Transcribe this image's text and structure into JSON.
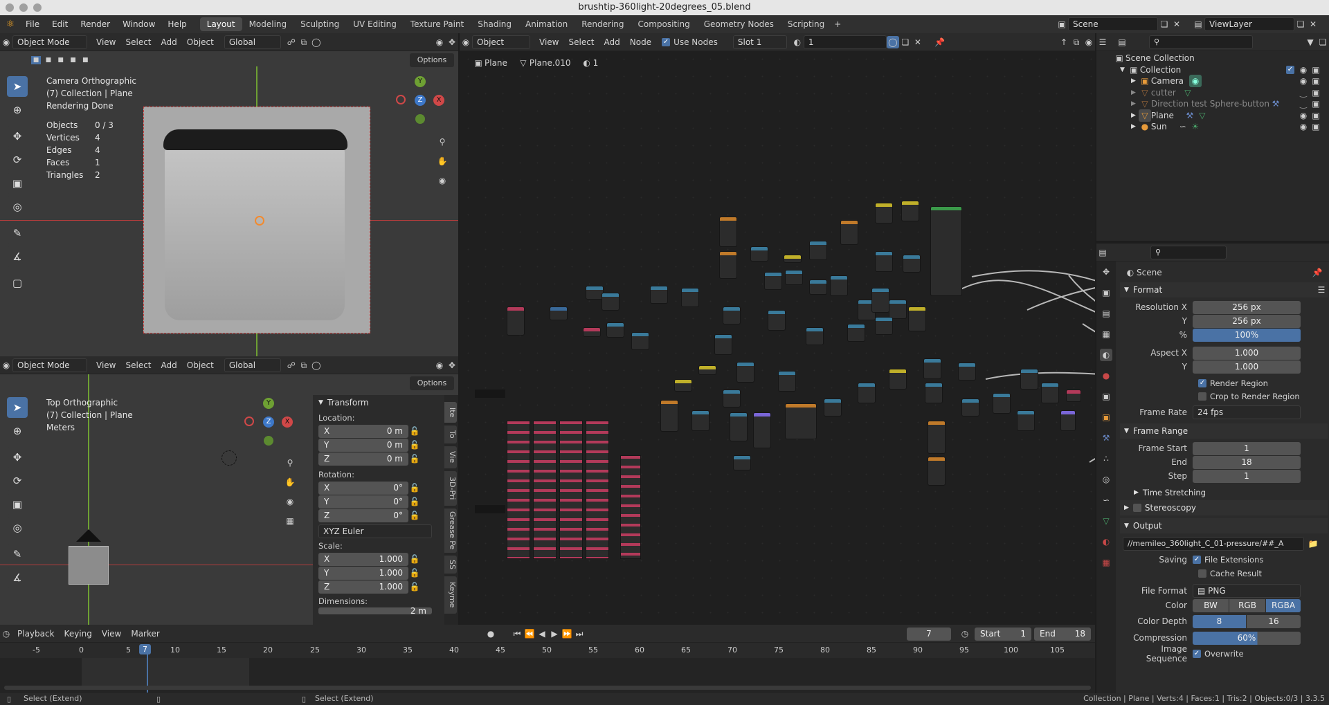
{
  "window": {
    "title": "brushtip-360light-20degrees_05.blend"
  },
  "menu": {
    "items": [
      "File",
      "Edit",
      "Render",
      "Window",
      "Help"
    ]
  },
  "workspaces": [
    "Layout",
    "Modeling",
    "Sculpting",
    "UV Editing",
    "Texture Paint",
    "Shading",
    "Animation",
    "Rendering",
    "Compositing",
    "Geometry Nodes",
    "Scripting"
  ],
  "active_workspace": "Layout",
  "scene_field": "Scene",
  "viewlayer_field": "ViewLayer",
  "viewport_top": {
    "mode": "Object Mode",
    "menus": [
      "View",
      "Select",
      "Add",
      "Object"
    ],
    "orientation": "Global",
    "options": "Options",
    "overlay": [
      "Camera Orthographic",
      "(7) Collection | Plane",
      "Rendering Done"
    ],
    "stats": [
      {
        "label": "Objects",
        "value": "0 / 3"
      },
      {
        "label": "Vertices",
        "value": "4"
      },
      {
        "label": "Edges",
        "value": "4"
      },
      {
        "label": "Faces",
        "value": "1"
      },
      {
        "label": "Triangles",
        "value": "2"
      }
    ],
    "gizmo": {
      "x": "X",
      "y": "Y",
      "z": "Z"
    }
  },
  "viewport_bottom": {
    "mode": "Object Mode",
    "menus": [
      "View",
      "Select",
      "Add",
      "Object"
    ],
    "orientation": "Global",
    "options": "Options",
    "overlay": [
      "Top Orthographic",
      "(7) Collection | Plane",
      "Meters"
    ],
    "transform": {
      "title": "Transform",
      "location_label": "Location:",
      "location": [
        {
          "axis": "X",
          "value": "0 m"
        },
        {
          "axis": "Y",
          "value": "0 m"
        },
        {
          "axis": "Z",
          "value": "0 m"
        }
      ],
      "rotation_label": "Rotation:",
      "rotation": [
        {
          "axis": "X",
          "value": "0°"
        },
        {
          "axis": "Y",
          "value": "0°"
        },
        {
          "axis": "Z",
          "value": "0°"
        }
      ],
      "rotation_mode": "XYZ Euler",
      "scale_label": "Scale:",
      "scale": [
        {
          "axis": "X",
          "value": "1.000"
        },
        {
          "axis": "Y",
          "value": "1.000"
        },
        {
          "axis": "Z",
          "value": "1.000"
        }
      ],
      "dimensions_label": "Dimensions:",
      "dimensions_x": "2 m"
    },
    "side_tabs": [
      "Ite",
      "To",
      "Vie",
      "3D-Pri",
      "Grease Pe",
      "SS",
      "Keyme"
    ]
  },
  "node_editor": {
    "type": "Object",
    "menus": [
      "View",
      "Select",
      "Add",
      "Node"
    ],
    "use_nodes": "Use Nodes",
    "slot": "Slot 1",
    "material_field": "1",
    "breadcrumb": [
      "Plane",
      "Plane.010",
      "1"
    ]
  },
  "outliner": {
    "items": [
      {
        "name": "Scene Collection",
        "indent": 0
      },
      {
        "name": "Collection",
        "indent": 1
      },
      {
        "name": "Camera",
        "indent": 2
      },
      {
        "name": "cutter",
        "indent": 2
      },
      {
        "name": "Direction test Sphere-button",
        "indent": 2
      },
      {
        "name": "Plane",
        "indent": 2
      },
      {
        "name": "Sun",
        "indent": 2
      }
    ]
  },
  "properties": {
    "context": "Scene",
    "format": {
      "title": "Format",
      "resolution_x_label": "Resolution X",
      "resolution_x": "256 px",
      "resolution_y_label": "Y",
      "resolution_y": "256 px",
      "percent_label": "%",
      "percent": "100%",
      "aspect_x_label": "Aspect X",
      "aspect_x": "1.000",
      "aspect_y_label": "Y",
      "aspect_y": "1.000",
      "render_region": "Render Region",
      "crop": "Crop to Render Region",
      "frame_rate_label": "Frame Rate",
      "frame_rate": "24 fps"
    },
    "frame_range": {
      "title": "Frame Range",
      "start_label": "Frame Start",
      "start": "1",
      "end_label": "End",
      "end": "18",
      "step_label": "Step",
      "step": "1",
      "time_stretching": "Time Stretching"
    },
    "stereoscopy": "Stereoscopy",
    "output": {
      "title": "Output",
      "path": "//memileo_360light_C_01-pressure/##_A",
      "saving_label": "Saving",
      "file_extensions": "File Extensions",
      "cache_result": "Cache Result",
      "file_format_label": "File Format",
      "file_format": "PNG",
      "color_label": "Color",
      "color_options": [
        "BW",
        "RGB",
        "RGBA"
      ],
      "color_depth_label": "Color Depth",
      "color_depth_options": [
        "8",
        "16"
      ],
      "compression_label": "Compression",
      "compression": "60%",
      "image_sequence_label": "Image Sequence",
      "overwrite": "Overwrite"
    }
  },
  "timeline": {
    "menus": [
      "Playback",
      "Keying",
      "View",
      "Marker"
    ],
    "current_frame": "7",
    "start_label": "Start",
    "start": "1",
    "end_label": "End",
    "end": "18",
    "ticks": [
      "-5",
      "0",
      "5",
      "7",
      "10",
      "15",
      "20",
      "25",
      "30",
      "35",
      "40",
      "45",
      "50",
      "55",
      "60",
      "65",
      "70",
      "75",
      "80",
      "85",
      "90",
      "95",
      "100",
      "105"
    ]
  },
  "statusbar": {
    "left": "Select (Extend)",
    "middle": "Select (Extend)",
    "right": "Collection | Plane | Verts:4 | Faces:1 | Tris:2 | Objects:0/3 | 3.3.5"
  },
  "colors": {
    "accent": "#4a72a5",
    "header": "#303030",
    "panel": "#2b2b2b",
    "viewport": "#3a3a3a",
    "green_axis": "#6ea033",
    "red_axis": "#b83c3c"
  }
}
